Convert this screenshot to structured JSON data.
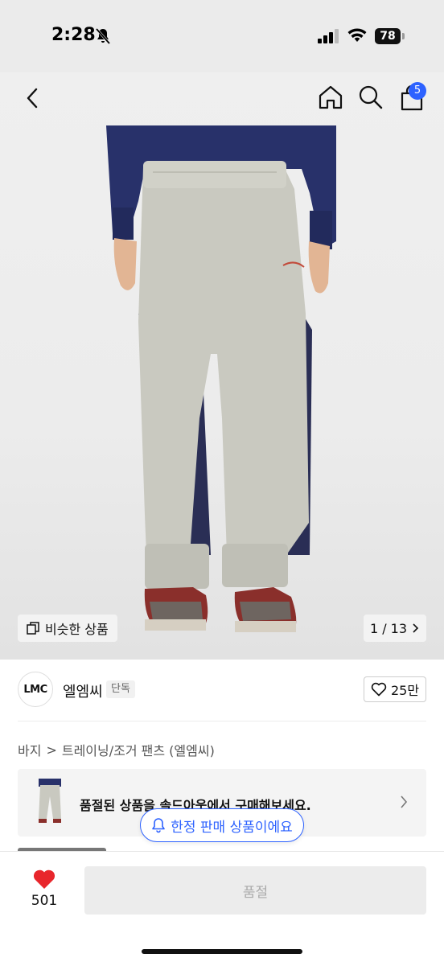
{
  "status": {
    "time": "2:28",
    "battery": "78"
  },
  "header": {
    "cart_count": "5"
  },
  "hero": {
    "similar_label": "비슷한 상품",
    "counter": "1 / 13"
  },
  "brand": {
    "logo_text": "LMC",
    "name": "엘엠씨",
    "badge": "단독",
    "like_count": "25만"
  },
  "breadcrumb": {
    "items": [
      "바지",
      "트레이닝/조거 팬츠 (엘엠씨)"
    ],
    "separator": ">"
  },
  "soldout_banner": {
    "text": "품절된 상품을 솔드아웃에서 구매해보세요."
  },
  "limited_pill": {
    "label": "한정 판매 상품이에요"
  },
  "bottom_bar": {
    "wish_count": "501",
    "buy_label": "품절"
  },
  "colors": {
    "accent": "#2d62ff",
    "heart": "#e8262c"
  }
}
